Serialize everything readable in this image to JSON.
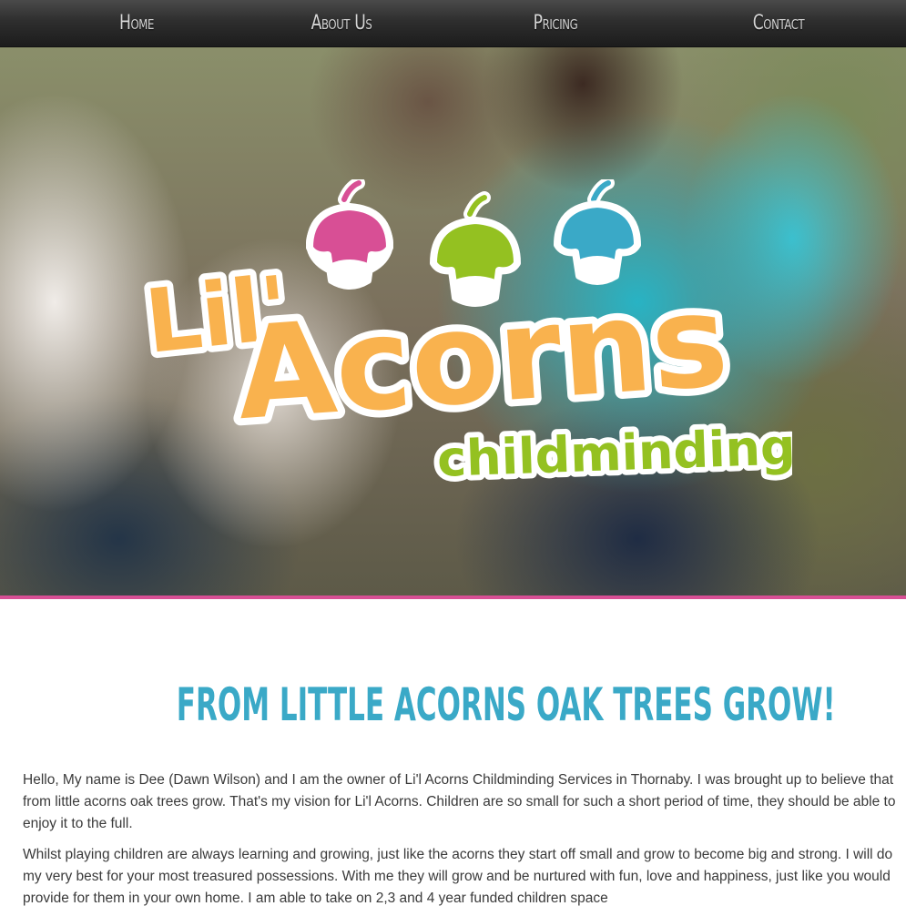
{
  "nav": {
    "items": [
      {
        "label": "Home"
      },
      {
        "label": "About Us"
      },
      {
        "label": "Pricing"
      },
      {
        "label": "Contact"
      }
    ]
  },
  "hero": {
    "logo": {
      "line1": "Lil'",
      "line2": "Acorns",
      "line3": "childminding",
      "colors": {
        "acorn_pink": "#d84f95",
        "acorn_green": "#94c121",
        "acorn_blue": "#3aa9c7",
        "text_orange": "#f9b24e",
        "text_green": "#94c121"
      }
    },
    "accent_line_color": "#d84f95"
  },
  "content": {
    "tagline": "From Little Acorns Oak Trees Grow!",
    "paragraphs": [
      "Hello, My name is Dee (Dawn Wilson) and I am the owner of Li'l Acorns Childminding Services in Thornaby. I was brought up to believe that from little acorns oak trees grow. That's my vision for Li'l Acorns. Children are so small for such a short period of time, they should be able to enjoy it to the full.",
      "Whilst playing children are always learning and growing, just like the acorns they start off small and grow to become big and strong. I will do my very best for your most treasured possessions. With me they will grow and be nurtured with fun, love and happiness, just like you would provide for them in your own home. I am able to take on 2,3 and 4 year funded children space"
    ]
  }
}
